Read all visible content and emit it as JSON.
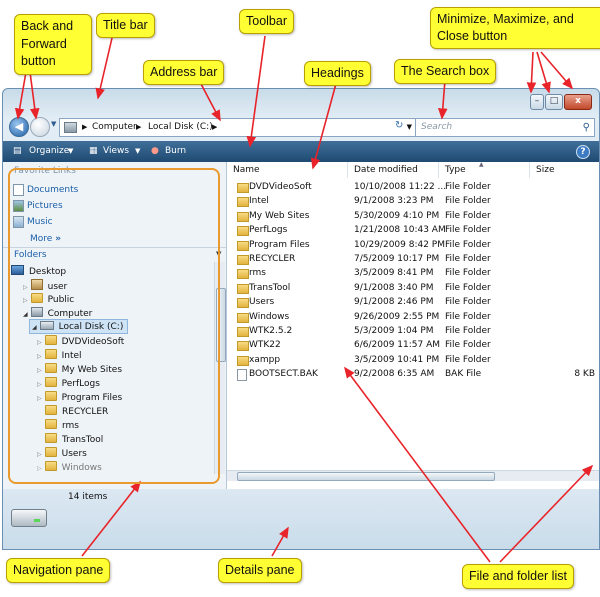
{
  "callouts": {
    "back_forward": "Back and Forward button",
    "title_bar": "Title bar",
    "toolbar": "Toolbar",
    "window_controls": "Minimize, Maximize, and Close button",
    "address_bar": "Address bar",
    "headings": "Headings",
    "search_box": "The Search box",
    "navigation_pane": "Navigation pane",
    "details_pane": "Details pane",
    "file_list": "File and folder list"
  },
  "address": {
    "segments": [
      "Computer",
      "Local Disk (C:)"
    ]
  },
  "search": {
    "placeholder": "Search"
  },
  "toolbar": {
    "organize": "Organize",
    "views": "Views",
    "burn": "Burn"
  },
  "nav": {
    "favorite_links_title": "Favorite Links",
    "favorite_links": [
      "Documents",
      "Pictures",
      "Music"
    ],
    "more": "More",
    "folders_title": "Folders",
    "tree": [
      {
        "label": "Desktop",
        "level": 0
      },
      {
        "label": "user",
        "level": 1
      },
      {
        "label": "Public",
        "level": 1
      },
      {
        "label": "Computer",
        "level": 1
      },
      {
        "label": "Local Disk (C:)",
        "level": 2
      },
      {
        "label": "DVDVideoSoft",
        "level": 3
      },
      {
        "label": "Intel",
        "level": 3
      },
      {
        "label": "My Web Sites",
        "level": 3
      },
      {
        "label": "PerfLogs",
        "level": 3
      },
      {
        "label": "Program Files",
        "level": 3
      },
      {
        "label": "RECYCLER",
        "level": 3
      },
      {
        "label": "rms",
        "level": 3
      },
      {
        "label": "TransTool",
        "level": 3
      },
      {
        "label": "Users",
        "level": 3
      },
      {
        "label": "Windows",
        "level": 3
      }
    ]
  },
  "columns": [
    "Name",
    "Date modified",
    "Type",
    "Size"
  ],
  "files": [
    {
      "name": "DVDVideoSoft",
      "date": "10/10/2008 11:22 ...",
      "type": "File Folder",
      "size": ""
    },
    {
      "name": "Intel",
      "date": "9/1/2008 3:23 PM",
      "type": "File Folder",
      "size": ""
    },
    {
      "name": "My Web Sites",
      "date": "5/30/2009 4:10 PM",
      "type": "File Folder",
      "size": ""
    },
    {
      "name": "PerfLogs",
      "date": "1/21/2008 10:43 AM",
      "type": "File Folder",
      "size": ""
    },
    {
      "name": "Program Files",
      "date": "10/29/2009 8:42 PM",
      "type": "File Folder",
      "size": ""
    },
    {
      "name": "RECYCLER",
      "date": "7/5/2009 10:17 PM",
      "type": "File Folder",
      "size": ""
    },
    {
      "name": "rms",
      "date": "3/5/2009 8:41 PM",
      "type": "File Folder",
      "size": ""
    },
    {
      "name": "TransTool",
      "date": "9/1/2008 3:40 PM",
      "type": "File Folder",
      "size": ""
    },
    {
      "name": "Users",
      "date": "9/1/2008 2:46 PM",
      "type": "File Folder",
      "size": ""
    },
    {
      "name": "Windows",
      "date": "9/26/2009 2:55 PM",
      "type": "File Folder",
      "size": ""
    },
    {
      "name": "WTK2.5.2",
      "date": "5/3/2009 1:04 PM",
      "type": "File Folder",
      "size": ""
    },
    {
      "name": "WTK22",
      "date": "6/6/2009 11:57 AM",
      "type": "File Folder",
      "size": ""
    },
    {
      "name": "xampp",
      "date": "3/5/2009 10:41 PM",
      "type": "File Folder",
      "size": ""
    },
    {
      "name": "BOOTSECT.BAK",
      "date": "9/2/2008 6:35 AM",
      "type": "BAK File",
      "size": "8 KB"
    }
  ],
  "details": {
    "item_count": "14 items"
  }
}
